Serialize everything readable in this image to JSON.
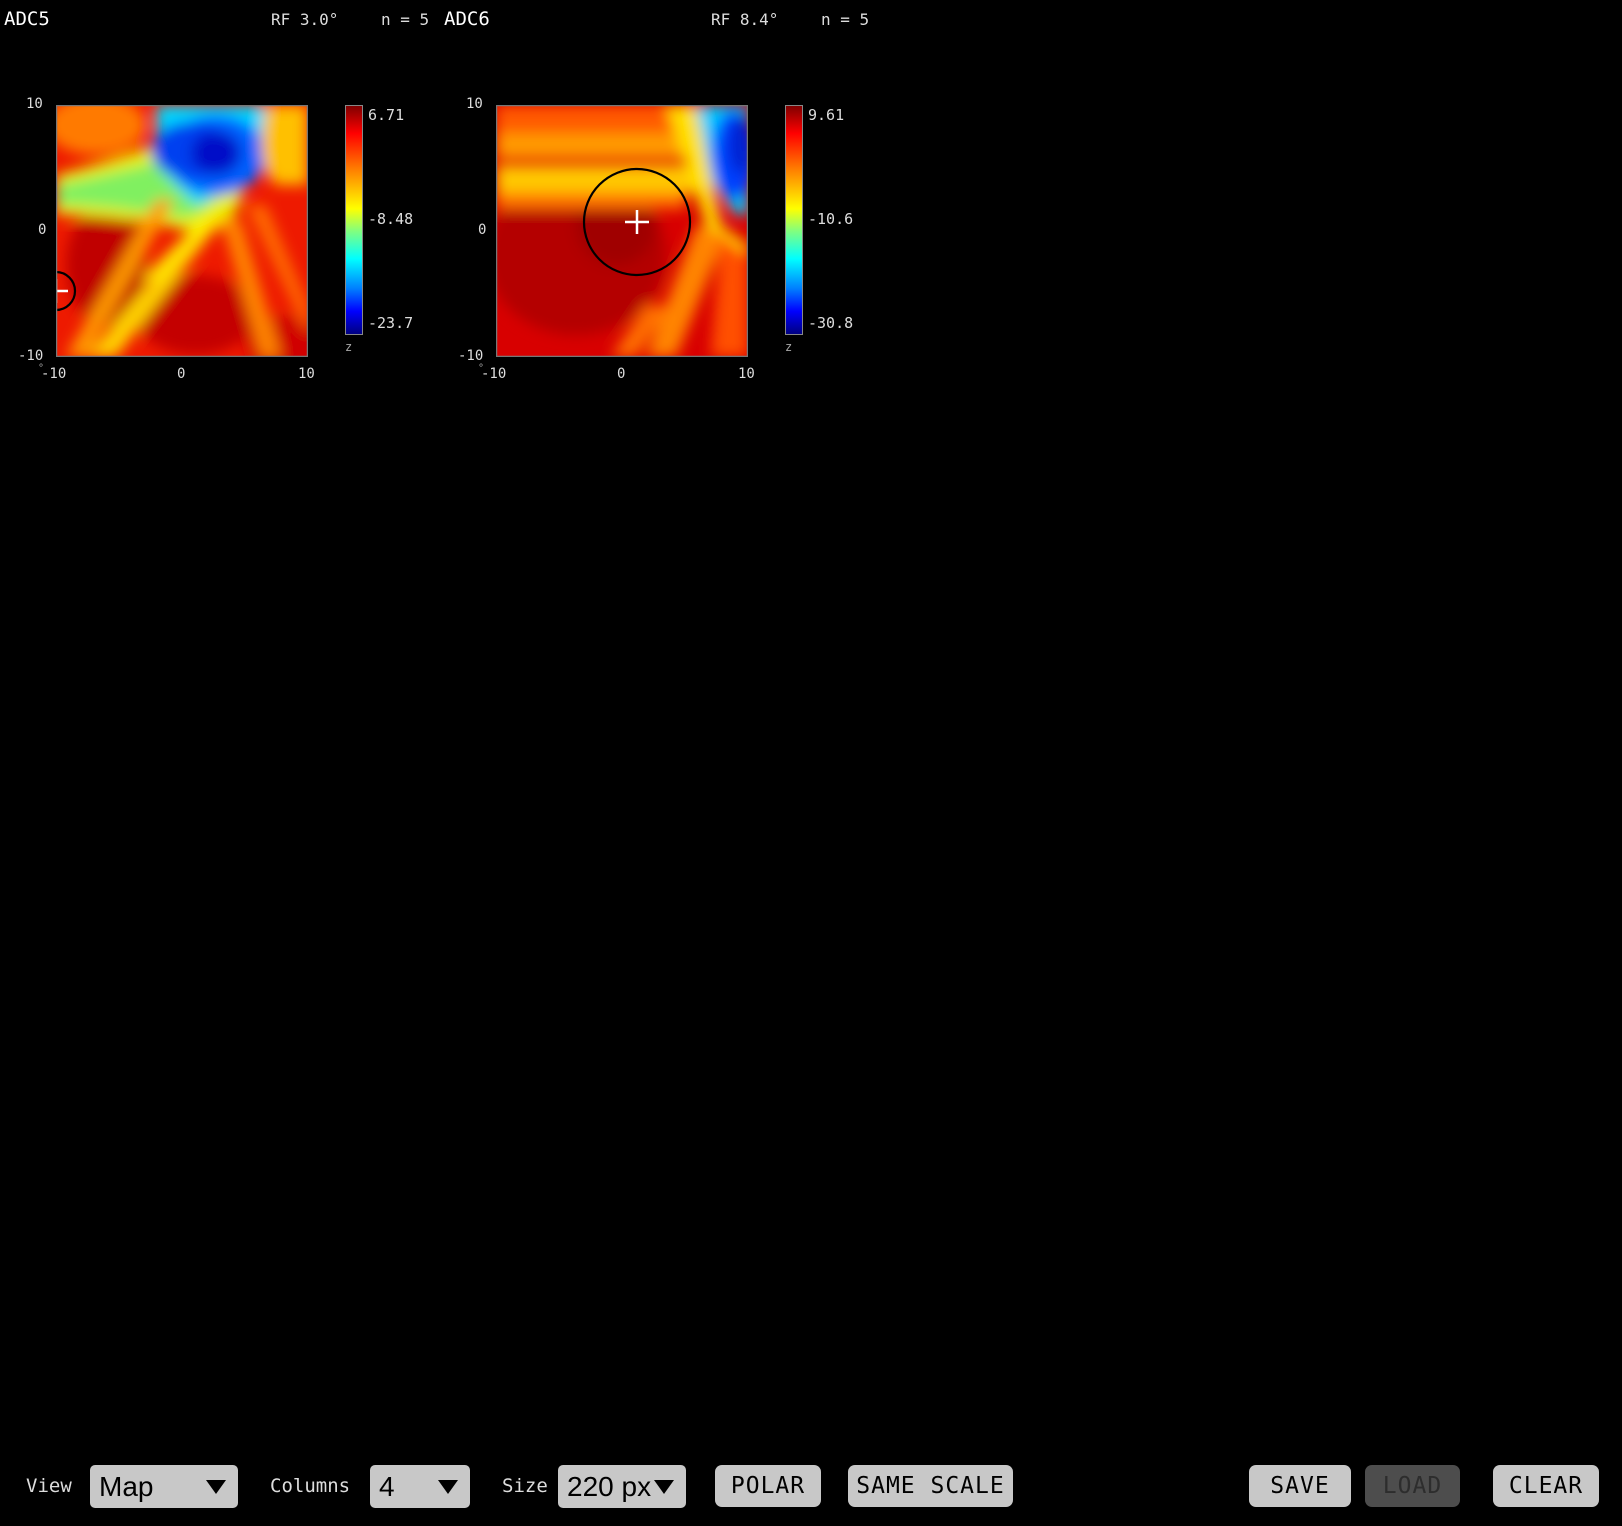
{
  "panels": [
    {
      "title": "ADC5",
      "rf": "RF 3.0°",
      "n": "n = 5",
      "cb_max": "6.71",
      "cb_mid": "-8.48",
      "cb_min": "-23.7",
      "cb_unit": "z"
    },
    {
      "title": "ADC6",
      "rf": "RF 8.4°",
      "n": "n = 5",
      "cb_max": "9.61",
      "cb_mid": "-10.6",
      "cb_min": "-30.8",
      "cb_unit": "z"
    }
  ],
  "axis": {
    "x_ticks": [
      "-10",
      "0",
      "10"
    ],
    "y_ticks": [
      "10",
      "0",
      "-10"
    ],
    "unit": "°"
  },
  "chart_data": [
    {
      "type": "heatmap",
      "title": "ADC5",
      "xlim": [
        -10,
        10
      ],
      "ylim": [
        -10,
        10
      ],
      "zlim": [
        -23.7,
        6.71
      ],
      "colormap": "jet",
      "rf_center": [
        -10,
        -5
      ],
      "rf_diameter_deg": 3.0
    },
    {
      "type": "heatmap",
      "title": "ADC6",
      "xlim": [
        -10,
        10
      ],
      "ylim": [
        -10,
        10
      ],
      "zlim": [
        -30.8,
        9.61
      ],
      "colormap": "jet",
      "rf_center": [
        1.3,
        0.7
      ],
      "rf_diameter_deg": 8.4
    }
  ],
  "toolbar": {
    "view_label": "View",
    "view_value": "Map",
    "columns_label": "Columns",
    "columns_value": "4",
    "size_label": "Size",
    "size_value": "220 px",
    "polar": "POLAR",
    "same_scale": "SAME SCALE",
    "save": "SAVE",
    "load": "LOAD",
    "clear": "CLEAR"
  },
  "colors": {
    "background": "#000000",
    "button": "#c8c8c8",
    "button_disabled": "#4d4d4d"
  }
}
